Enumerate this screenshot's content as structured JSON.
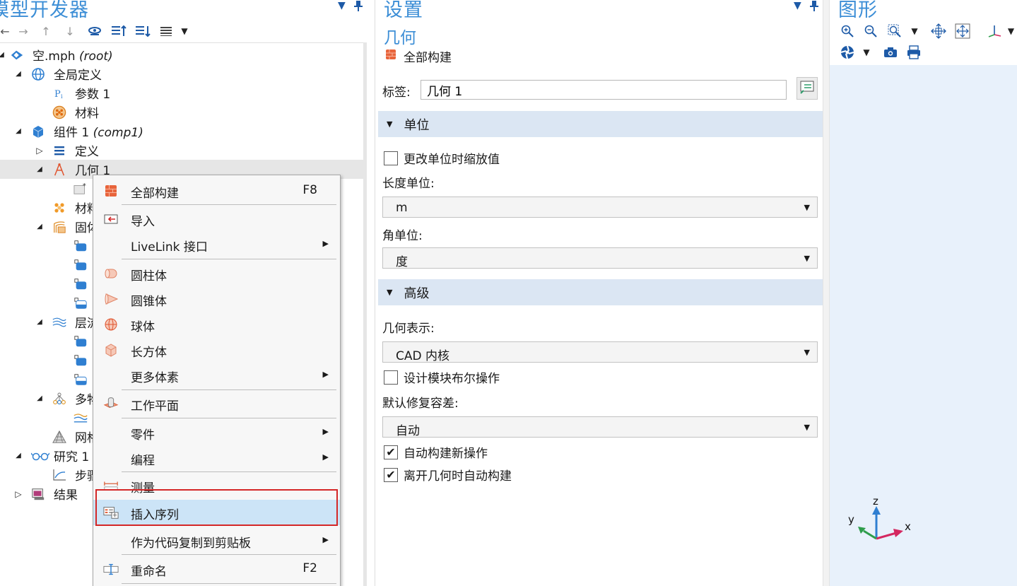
{
  "model_builder": {
    "title": "模型开发器",
    "tree": [
      {
        "label": "空.mph",
        "tag": "(root)",
        "icon": "mph-file-icon"
      },
      {
        "label": "全局定义",
        "tag": "",
        "icon": "globe-icon"
      },
      {
        "label": "参数 1",
        "tag": "",
        "icon": "parameters-icon"
      },
      {
        "label": "材料",
        "tag": "",
        "icon": "materials-icon"
      },
      {
        "label": "组件 1",
        "tag": "(comp1)",
        "icon": "component-cube-icon"
      },
      {
        "label": "定义",
        "tag": "",
        "icon": "definitions-icon"
      },
      {
        "label": "几何 1",
        "tag": "",
        "icon": "geometry-icon"
      },
      {
        "label": "",
        "tag": "",
        "icon": "geometry-sub-node-icon"
      },
      {
        "label": "材料",
        "tag": "",
        "icon": "materials-icon"
      },
      {
        "label": "固体",
        "tag": "",
        "icon": "solid-mechanics-icon"
      },
      {
        "label": "",
        "tag": "",
        "icon": "physics-feature-icon"
      },
      {
        "label": "",
        "tag": "",
        "icon": "physics-feature-icon"
      },
      {
        "label": "",
        "tag": "",
        "icon": "physics-feature-icon"
      },
      {
        "label": "",
        "tag": "",
        "icon": "physics-feature-icon"
      },
      {
        "label": "层流",
        "tag": "",
        "icon": "laminar-flow-icon"
      },
      {
        "label": "",
        "tag": "",
        "icon": "physics-feature-icon"
      },
      {
        "label": "",
        "tag": "",
        "icon": "physics-feature-icon"
      },
      {
        "label": "",
        "tag": "",
        "icon": "physics-feature-icon"
      },
      {
        "label": "多物",
        "tag": "",
        "icon": "multiphysics-icon"
      },
      {
        "label": "",
        "tag": "",
        "icon": "multiphysics-coupling-icon"
      },
      {
        "label": "网格",
        "tag": "",
        "icon": "mesh-icon"
      },
      {
        "label": "研究 1",
        "tag": "",
        "icon": "study-icon"
      },
      {
        "label": "步骤",
        "tag": "",
        "icon": "study-step-icon"
      },
      {
        "label": "结果",
        "tag": "",
        "icon": "results-icon"
      }
    ]
  },
  "context_menu": {
    "items": [
      {
        "label": "全部构建",
        "shortcut": "F8",
        "submenu": false,
        "icon": "build-all-icon"
      },
      {
        "label": "导入",
        "shortcut": "",
        "submenu": false,
        "icon": "import-icon"
      },
      {
        "label": "LiveLink 接口",
        "shortcut": "",
        "submenu": true,
        "icon": ""
      },
      {
        "label": "圆柱体",
        "shortcut": "",
        "submenu": false,
        "icon": "cylinder-icon"
      },
      {
        "label": "圆锥体",
        "shortcut": "",
        "submenu": false,
        "icon": "cone-icon"
      },
      {
        "label": "球体",
        "shortcut": "",
        "submenu": false,
        "icon": "sphere-icon"
      },
      {
        "label": "长方体",
        "shortcut": "",
        "submenu": false,
        "icon": "block-icon"
      },
      {
        "label": "更多体素",
        "shortcut": "",
        "submenu": true,
        "icon": ""
      },
      {
        "label": "工作平面",
        "shortcut": "",
        "submenu": false,
        "icon": "work-plane-icon"
      },
      {
        "label": "零件",
        "shortcut": "",
        "submenu": true,
        "icon": ""
      },
      {
        "label": "编程",
        "shortcut": "",
        "submenu": true,
        "icon": ""
      },
      {
        "label": "测量",
        "shortcut": "",
        "submenu": false,
        "icon": "measure-icon"
      },
      {
        "label": "插入序列",
        "shortcut": "",
        "submenu": false,
        "icon": "insert-sequence-icon",
        "highlighted": true
      },
      {
        "label": "作为代码复制到剪贴板",
        "shortcut": "",
        "submenu": true,
        "icon": ""
      },
      {
        "label": "重命名",
        "shortcut": "F2",
        "submenu": false,
        "icon": "rename-icon"
      }
    ]
  },
  "settings": {
    "title": "设置",
    "subtitle": "几何",
    "build_all": "全部构建",
    "label_caption": "标签:",
    "label_value": "几何 1",
    "units_section": "单位",
    "scale_values": "更改单位时缩放值",
    "scale_values_checked": false,
    "length_unit_label": "长度单位:",
    "length_unit": "m",
    "angular_unit_label": "角单位:",
    "angular_unit": "度",
    "advanced_section": "高级",
    "geometry_rep_label": "几何表示:",
    "geometry_rep": "CAD 内核",
    "design_boolean": "设计模块布尔操作",
    "design_boolean_checked": false,
    "repair_tol_label": "默认修复容差:",
    "repair_tol": "自动",
    "auto_build_new": "自动构建新操作",
    "auto_build_new_checked": true,
    "auto_build_leave": "离开几何时自动构建",
    "auto_build_leave_checked": true
  },
  "graphics": {
    "title": "图形",
    "axis_labels": {
      "x": "x",
      "y": "y",
      "z": "z"
    }
  },
  "colors": {
    "accent": "#3c8ed6",
    "section_bg": "#dbe6f3",
    "menu_highlight": "#cce4f7",
    "highlight_box": "#d42727",
    "canvas_bg": "#e8f1fb"
  }
}
